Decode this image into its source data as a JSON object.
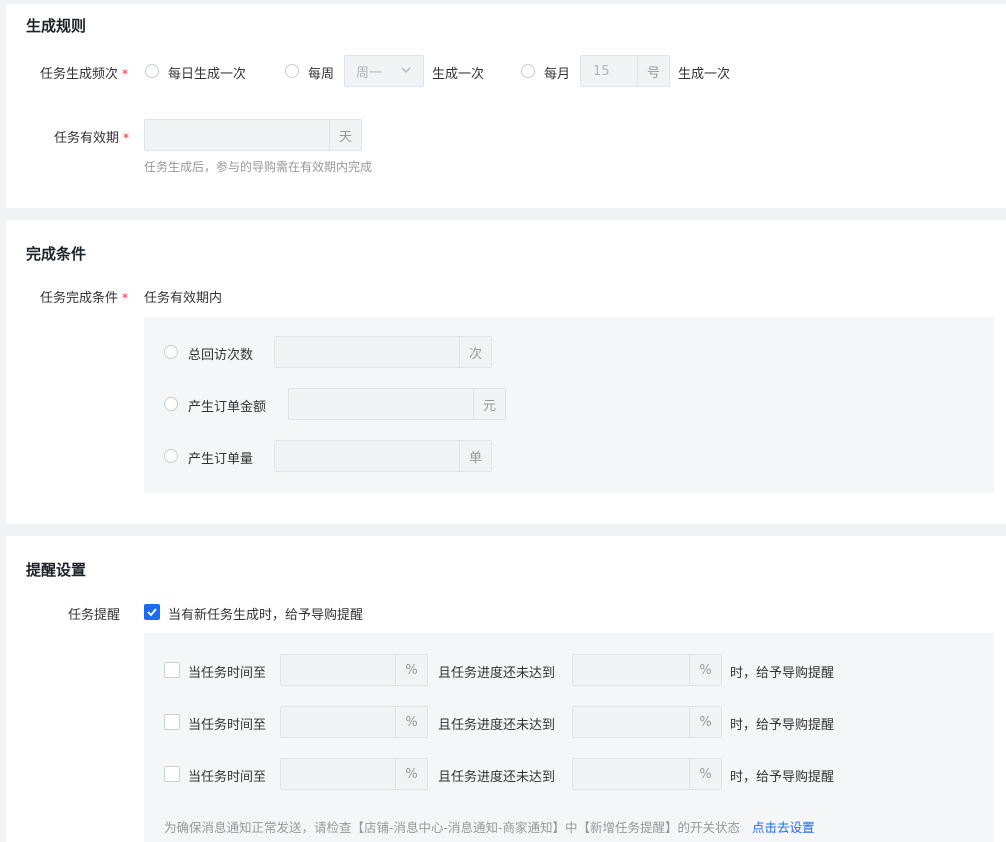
{
  "sections": {
    "generate": {
      "title": "生成规则",
      "frequency_label": "任务生成频次",
      "required_mark": "*",
      "daily_option": "每日生成一次",
      "weekly_prefix": "每周",
      "weekly_select_value": "周一",
      "weekly_suffix": "生成一次",
      "monthly_prefix": "每月",
      "monthly_day_value": "15",
      "monthly_day_unit": "号",
      "monthly_suffix": "生成一次",
      "validity_label": "任务有效期",
      "validity_unit": "天",
      "validity_hint": "任务生成后，参与的导购需在有效期内完成"
    },
    "complete": {
      "title": "完成条件",
      "condition_label": "任务完成条件",
      "required_mark": "*",
      "condition_text": "任务有效期内",
      "options": [
        {
          "label": "总回访次数",
          "unit": "次"
        },
        {
          "label": "产生订单金额",
          "unit": "元"
        },
        {
          "label": "产生订单量",
          "unit": "单"
        }
      ]
    },
    "remind": {
      "title": "提醒设置",
      "remind_label": "任务提醒",
      "remind_checkbox_text": "当有新任务生成时，给予导购提醒",
      "remind_checked": true,
      "rules": [
        {
          "prefix": "当任务时间至",
          "unit1": "%",
          "middle": "且任务进度还未达到",
          "unit2": "%",
          "suffix": "时，给予导购提醒"
        },
        {
          "prefix": "当任务时间至",
          "unit1": "%",
          "middle": "且任务进度还未达到",
          "unit2": "%",
          "suffix": "时，给予导购提醒"
        },
        {
          "prefix": "当任务时间至",
          "unit1": "%",
          "middle": "且任务进度还未达到",
          "unit2": "%",
          "suffix": "时，给予导购提醒"
        }
      ],
      "notice_text": "为确保消息通知正常发送，请检查【店铺-消息中心-消息通知-商家通知】中【新增任务提醒】的开关状态",
      "notice_link": "点击去设置"
    }
  },
  "colors": {
    "accent": "#1b6cf2",
    "required": "#f5222d",
    "page_bg": "#f2f3f5"
  },
  "icons": {
    "dropdown": "chevron-down-icon",
    "check": "check-icon"
  }
}
